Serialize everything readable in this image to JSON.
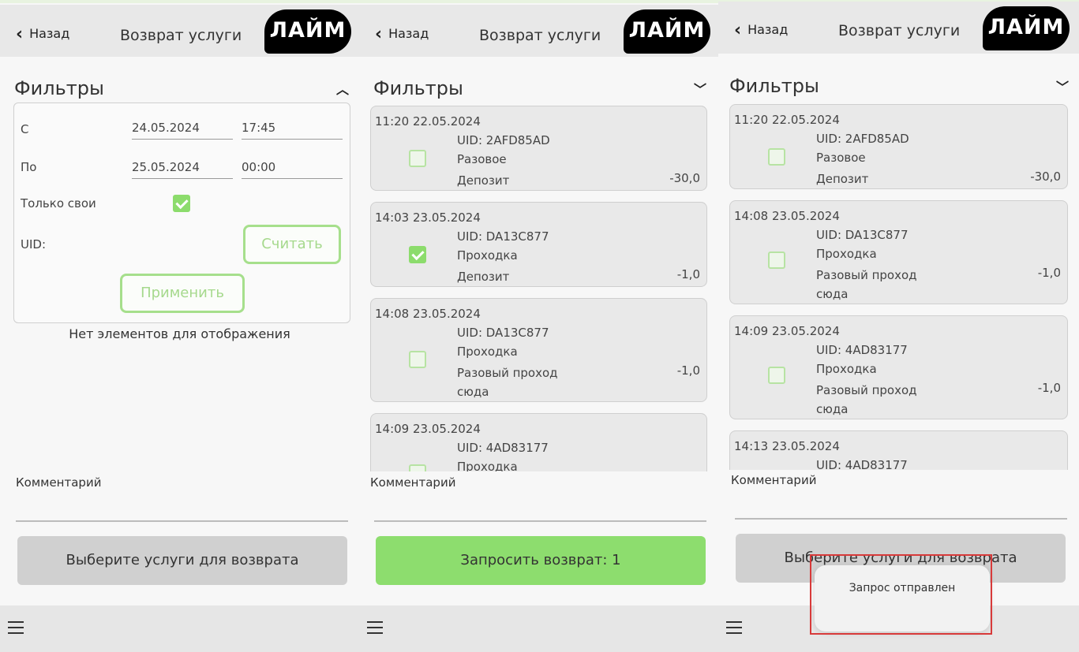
{
  "screens": [
    {
      "header": {
        "back_label": "Назад",
        "title": "Возврат услуги",
        "logo_text": "ЛАЙМ"
      },
      "filters": {
        "title": "Фильтры",
        "expanded": true,
        "from_label": "С",
        "from_date": "24.05.2024",
        "from_time": "17:45",
        "to_label": "По",
        "to_date": "25.05.2024",
        "to_time": "00:00",
        "only_mine_label": "Только свои",
        "only_mine_checked": true,
        "uid_label": "UID:",
        "read_button": "Считать",
        "apply_button": "Применить"
      },
      "empty_text": "Нет элементов для отображения",
      "comment_label": "Комментарий",
      "action_button": "Выберите услуги для возврата"
    },
    {
      "header": {
        "back_label": "Назад",
        "title": "Возврат услуги",
        "logo_text": "ЛАЙМ"
      },
      "filters": {
        "title": "Фильтры",
        "expanded": false
      },
      "items": [
        {
          "timestamp": "11:20 22.05.2024",
          "uid": "UID: 2AFD85AD",
          "type": "Разовое",
          "tariff": "Депозит",
          "amount": "-30,0",
          "checked": false
        },
        {
          "timestamp": "14:03 23.05.2024",
          "uid": "UID: DA13C877",
          "type": "Проходка",
          "tariff": "Депозит",
          "amount": "-1,0",
          "checked": true
        },
        {
          "timestamp": "14:08 23.05.2024",
          "uid": "UID: DA13C877",
          "type": "Проходка",
          "tariff": "Разовый проход сюда",
          "amount": "-1,0",
          "checked": false
        },
        {
          "timestamp": "14:09 23.05.2024",
          "uid": "UID: 4AD83177",
          "type": "Проходка",
          "tariff": "",
          "amount": "",
          "checked": false
        }
      ],
      "comment_label": "Комментарий",
      "action_button": "Запросить возврат: 1"
    },
    {
      "header": {
        "back_label": "Назад",
        "title": "Возврат услуги",
        "logo_text": "ЛАЙМ"
      },
      "filters": {
        "title": "Фильтры",
        "expanded": false
      },
      "items": [
        {
          "timestamp": "11:20 22.05.2024",
          "uid": "UID: 2AFD85AD",
          "type": "Разовое",
          "tariff": "Депозит",
          "amount": "-30,0",
          "checked": false
        },
        {
          "timestamp": "14:08 23.05.2024",
          "uid": "UID: DA13C877",
          "type": "Проходка",
          "tariff": "Разовый проход сюда",
          "amount": "-1,0",
          "checked": false
        },
        {
          "timestamp": "14:09 23.05.2024",
          "uid": "UID: 4AD83177",
          "type": "Проходка",
          "tariff": "Разовый проход сюда",
          "amount": "-1,0",
          "checked": false
        },
        {
          "timestamp": "14:13 23.05.2024",
          "uid": "UID: 4AD83177",
          "type": "",
          "tariff": "",
          "amount": "",
          "checked": false
        }
      ],
      "comment_label": "Комментарий",
      "action_button": "Выберите услуги для возврата",
      "toast": "Запрос отправлен"
    }
  ],
  "colors": {
    "accent_green": "#8ddd6e",
    "logo_bg": "#000000",
    "highlight_red": "#d83a3a"
  }
}
